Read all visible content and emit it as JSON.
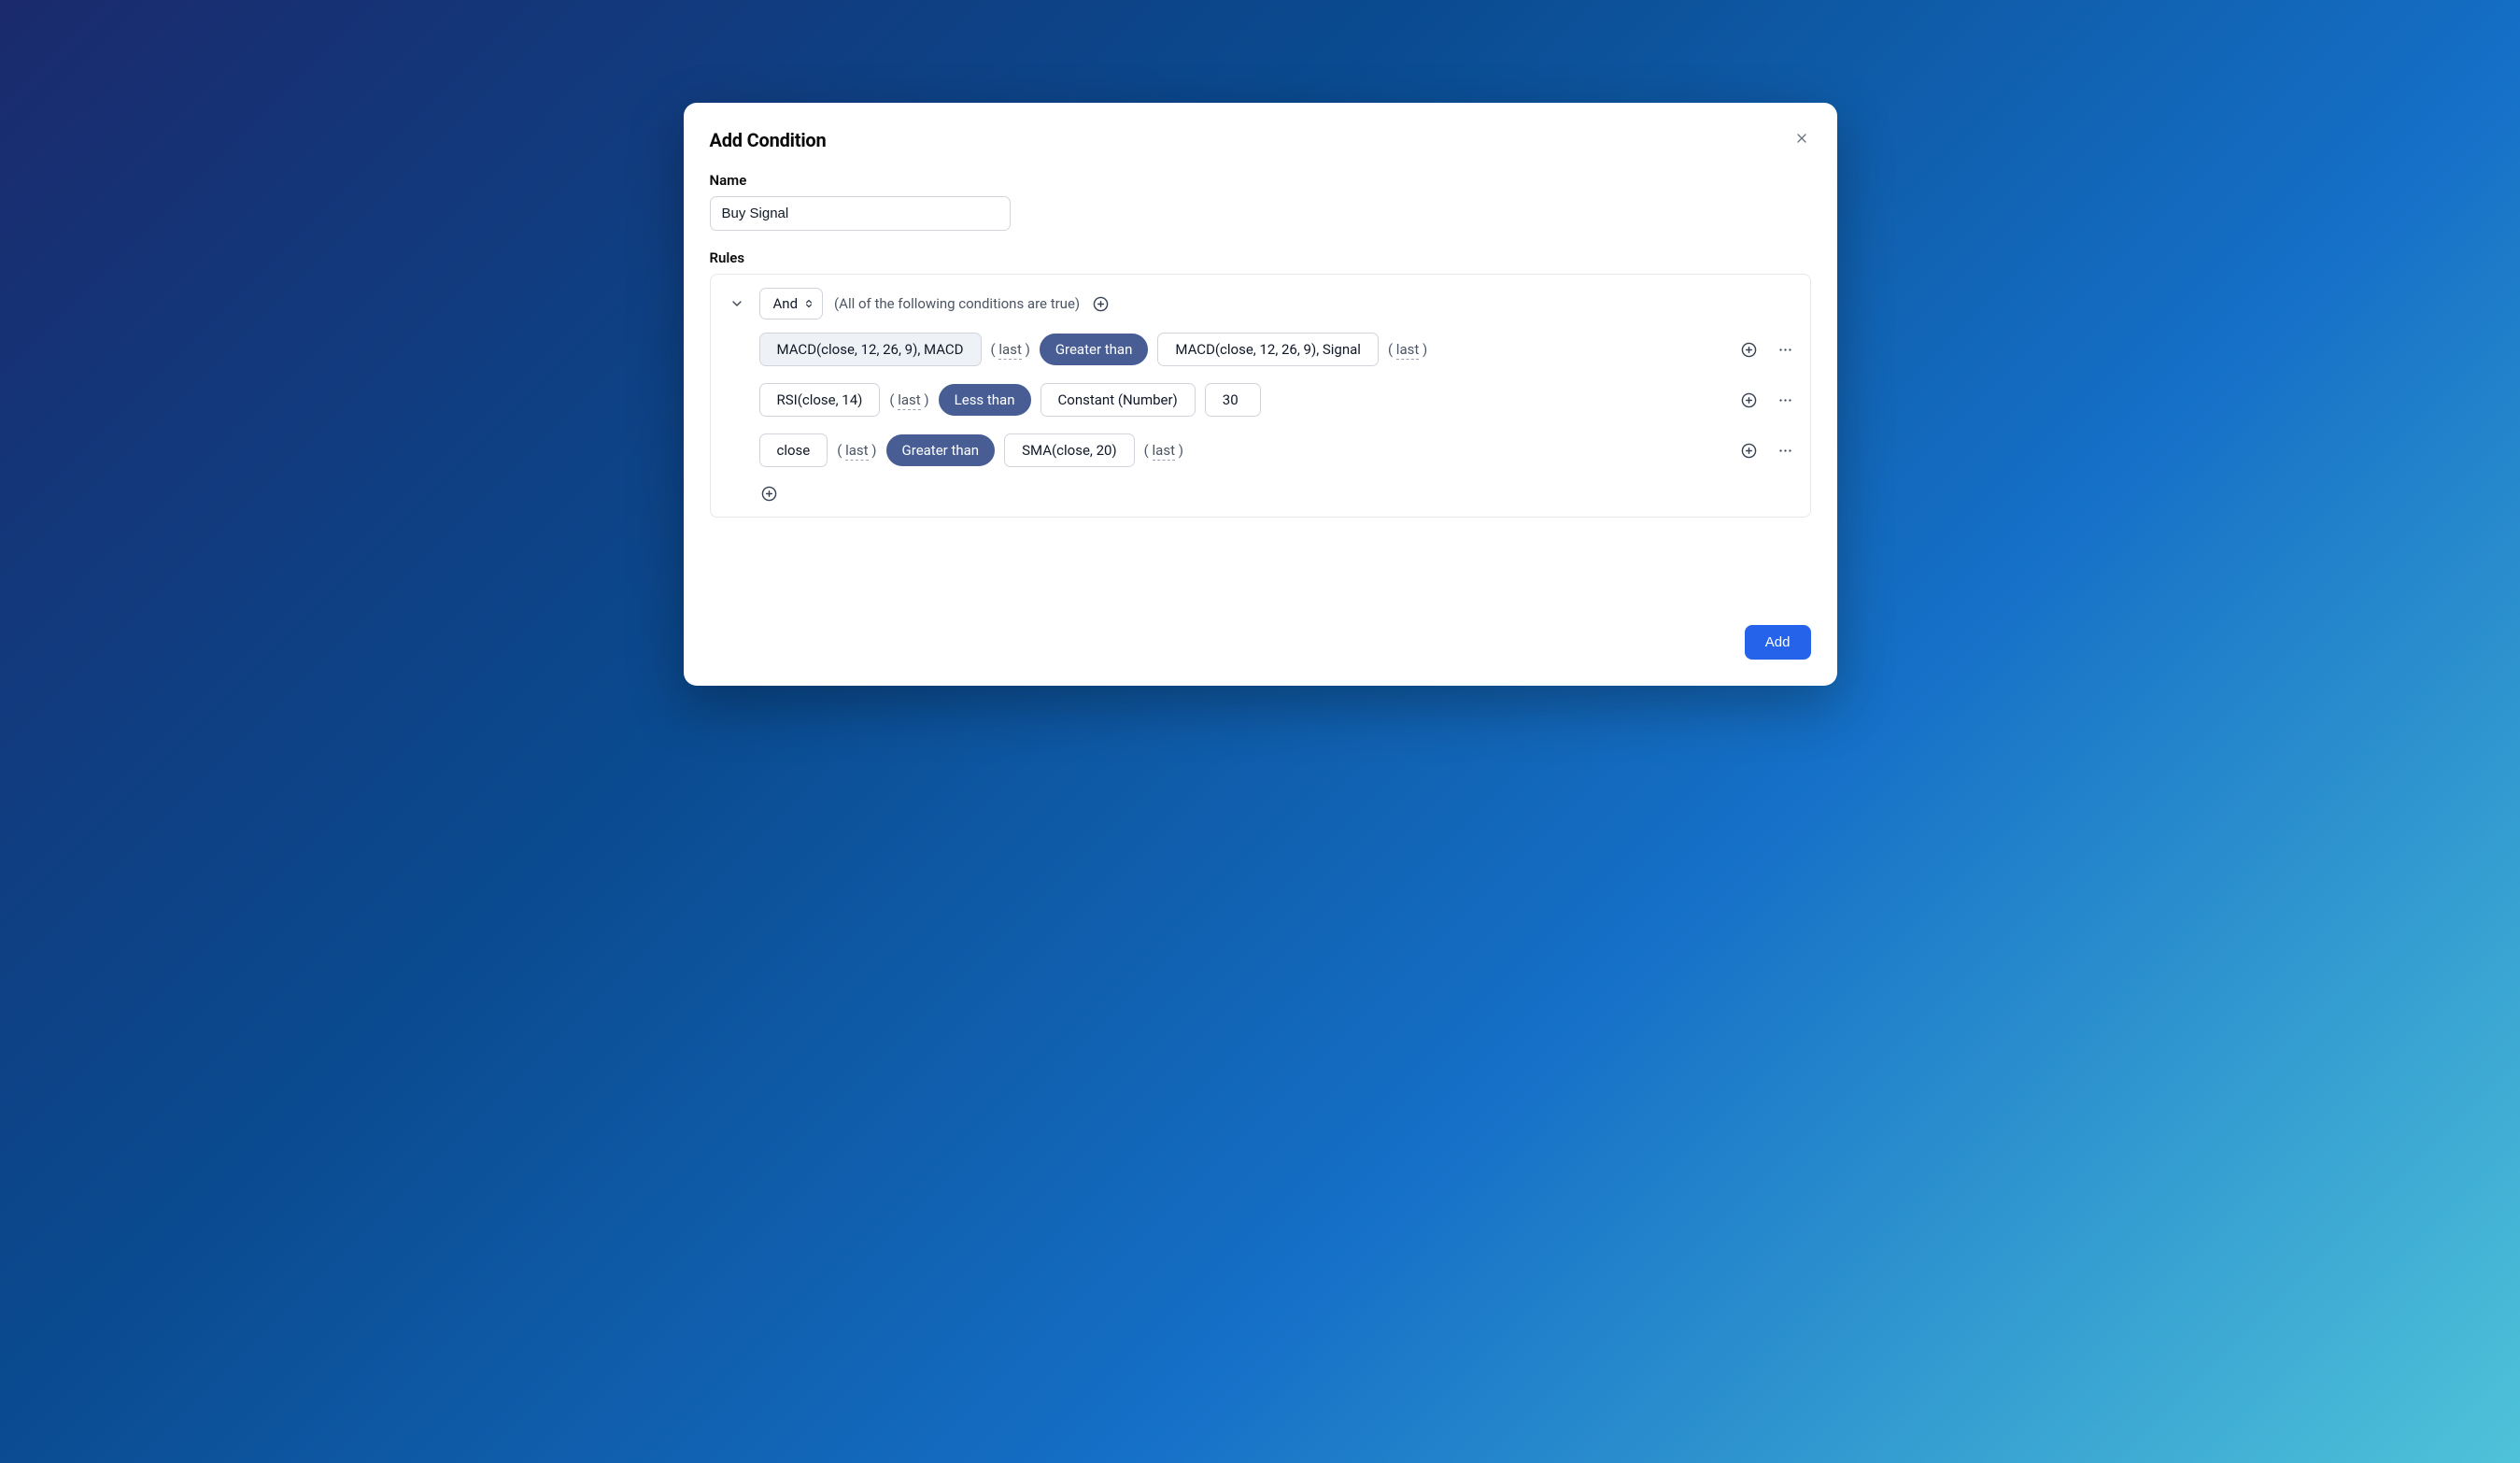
{
  "modal": {
    "title": "Add Condition",
    "nameLabel": "Name",
    "nameValue": "Buy Signal",
    "rulesLabel": "Rules",
    "addButton": "Add"
  },
  "group": {
    "operator": "And",
    "description": "(All of the following conditions are true)"
  },
  "rules": [
    {
      "left": "MACD(close, 12, 26, 9), MACD",
      "leftLast": "last",
      "operator": "Greater than",
      "rightType": "indicator",
      "right": "MACD(close, 12, 26, 9), Signal",
      "rightLast": "last"
    },
    {
      "left": "RSI(close, 14)",
      "leftLast": "last",
      "operator": "Less than",
      "rightType": "constant",
      "rightLabel": "Constant (Number)",
      "rightValue": "30"
    },
    {
      "left": "close",
      "leftLast": "last",
      "operator": "Greater than",
      "rightType": "indicator",
      "right": "SMA(close, 20)",
      "rightLast": "last"
    }
  ]
}
